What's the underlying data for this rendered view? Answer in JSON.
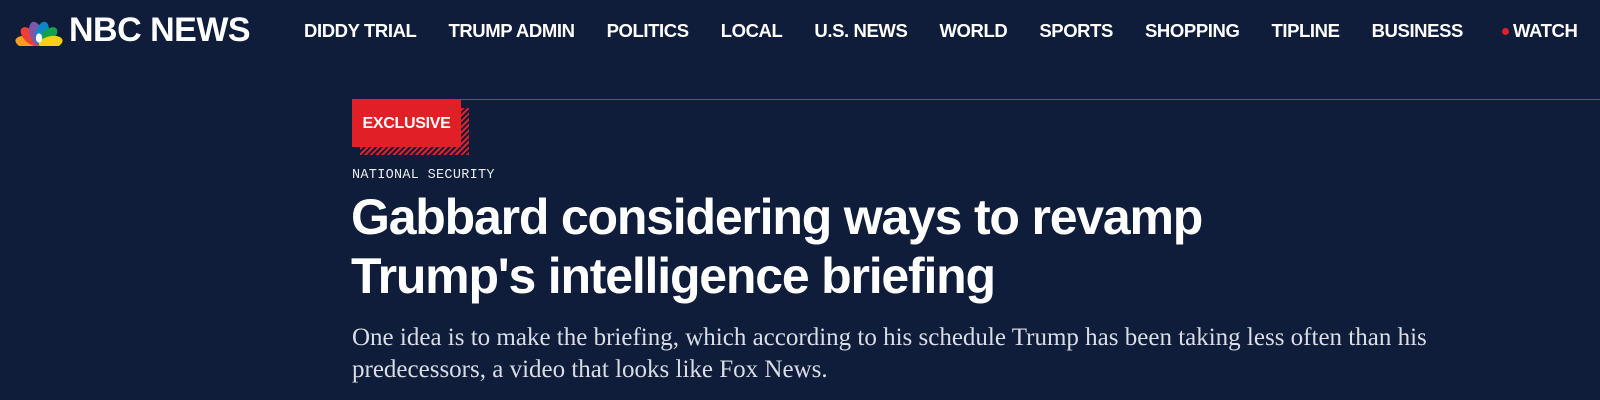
{
  "header": {
    "logo_text": "NBC NEWS",
    "nav": [
      {
        "label": "DIDDY TRIAL"
      },
      {
        "label": "TRUMP ADMIN"
      },
      {
        "label": "POLITICS"
      },
      {
        "label": "LOCAL"
      },
      {
        "label": "U.S. NEWS"
      },
      {
        "label": "WORLD"
      },
      {
        "label": "SPORTS"
      },
      {
        "label": "SHOPPING"
      },
      {
        "label": "TIPLINE"
      },
      {
        "label": "BUSINESS"
      }
    ],
    "watch_label": "WATCH"
  },
  "article": {
    "badge": "EXCLUSIVE",
    "section": "NATIONAL SECURITY",
    "headline": "Gabbard considering ways to revamp Trump's intelligence briefing",
    "dek": "One idea is to make the briefing, which according to his schedule Trump has been taking less often than his predecessors, a video that looks like Fox News."
  },
  "colors": {
    "background": "#0f1d3a",
    "accent_red": "#e01f26",
    "text": "#ffffff"
  },
  "icons": {
    "logo": "nbc-peacock-icon",
    "live": "live-dot-icon"
  }
}
